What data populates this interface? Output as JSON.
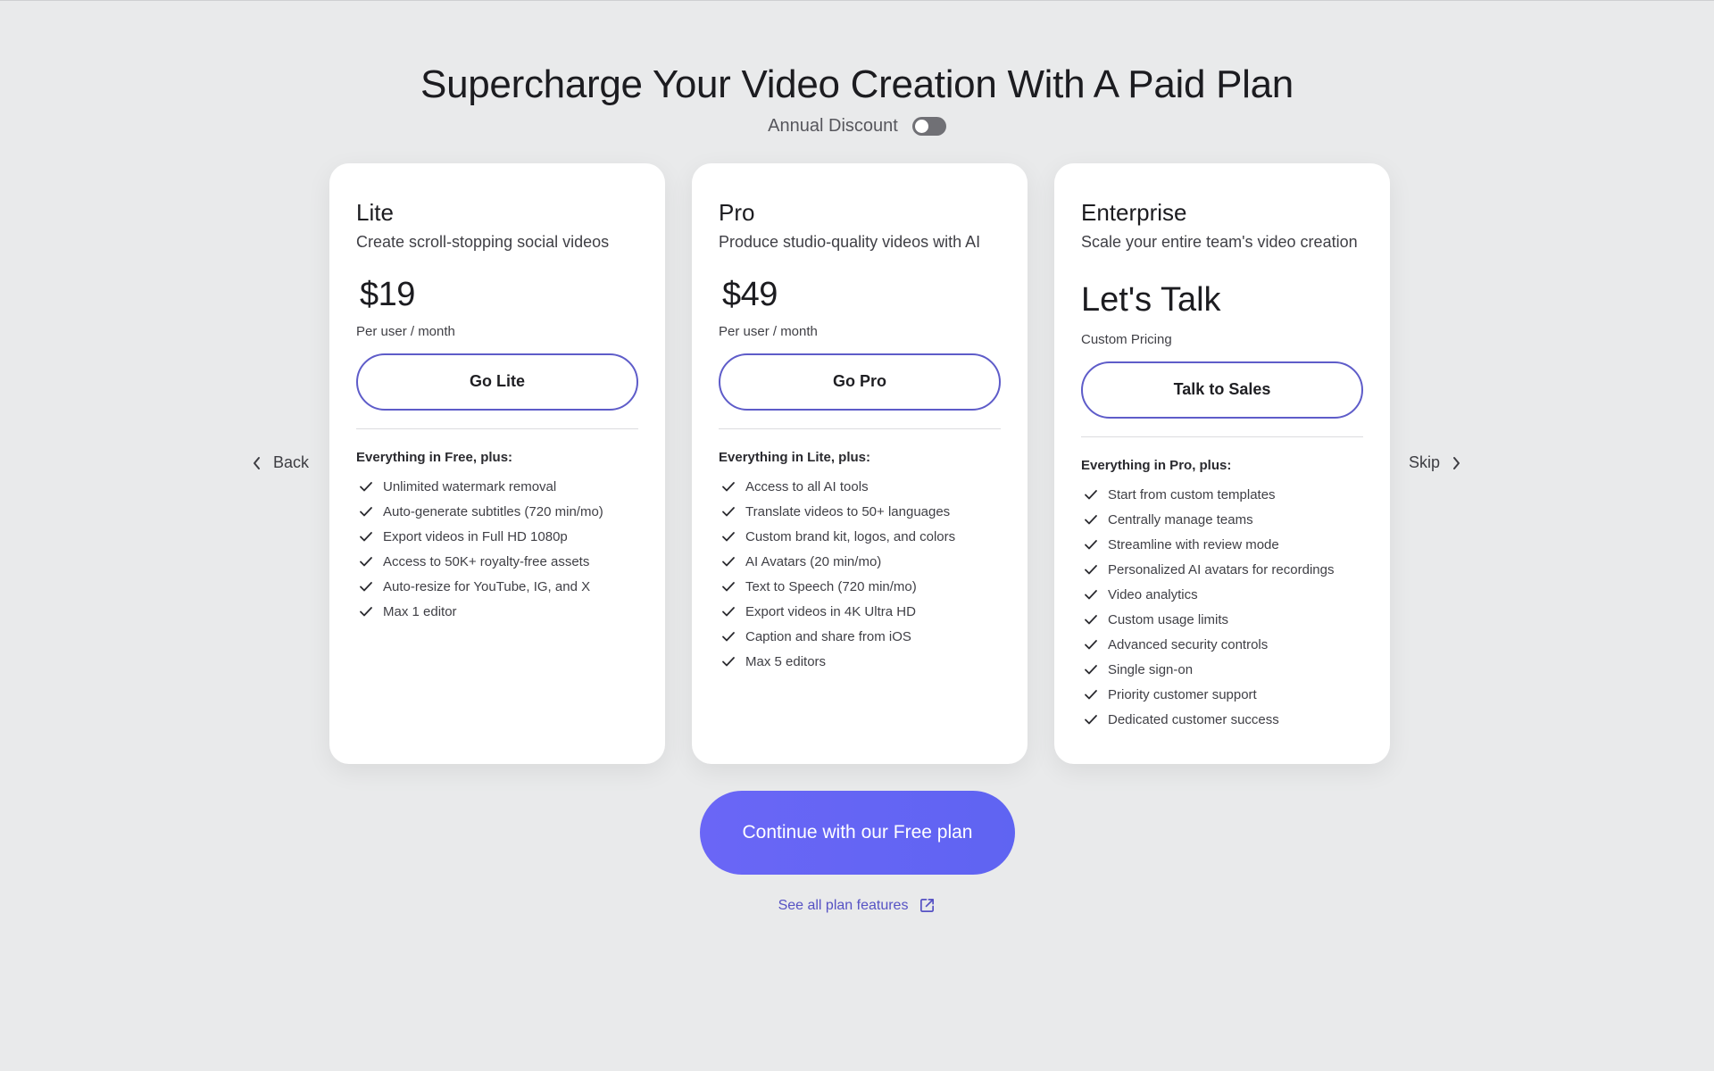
{
  "header": {
    "title": "Supercharge Your Video Creation With A Paid Plan",
    "discount_label": "Annual Discount",
    "discount_on": false
  },
  "nav": {
    "back_label": "Back",
    "skip_label": "Skip"
  },
  "plans": [
    {
      "name": "Lite",
      "description": "Create scroll-stopping social videos",
      "price": "$19",
      "price_note": "Per user / month",
      "button_label": "Go Lite",
      "features_heading": "Everything in Free, plus:",
      "features": [
        "Unlimited watermark removal",
        "Auto-generate subtitles (720 min/mo)",
        "Export videos in Full HD 1080p",
        "Access to 50K+ royalty-free assets",
        "Auto-resize for YouTube, IG, and X",
        "Max 1 editor"
      ]
    },
    {
      "name": "Pro",
      "description": "Produce studio-quality videos with AI",
      "price": "$49",
      "price_note": "Per user / month",
      "button_label": "Go Pro",
      "features_heading": "Everything in Lite, plus:",
      "features": [
        "Access to all AI tools",
        "Translate videos to 50+ languages",
        "Custom brand kit, logos, and colors",
        "AI Avatars (20 min/mo)",
        "Text to Speech (720 min/mo)",
        "Export videos in 4K Ultra HD",
        "Caption and share from iOS",
        "Max 5 editors"
      ]
    },
    {
      "name": "Enterprise",
      "description": "Scale your entire team's video creation",
      "price": "Let's Talk",
      "price_note": "Custom Pricing",
      "button_label": "Talk to Sales",
      "features_heading": "Everything in Pro, plus:",
      "features": [
        "Start from custom templates",
        "Centrally manage teams",
        "Streamline with review mode",
        "Personalized AI avatars for recordings",
        "Video analytics",
        "Custom usage limits",
        "Advanced security controls",
        "Single sign-on",
        "Priority customer support",
        "Dedicated customer success"
      ]
    }
  ],
  "footer": {
    "cta_label": "Continue with our Free plan",
    "see_all_label": "See all plan features"
  },
  "icons": {
    "back": "chevron-left-icon",
    "skip": "chevron-right-icon",
    "feature": "check-icon",
    "see_all": "external-link-icon"
  },
  "colors": {
    "background": "#e9eaeb",
    "accent": "#5e5cc9",
    "cta": "#6a66f6",
    "link": "#5652c4"
  }
}
